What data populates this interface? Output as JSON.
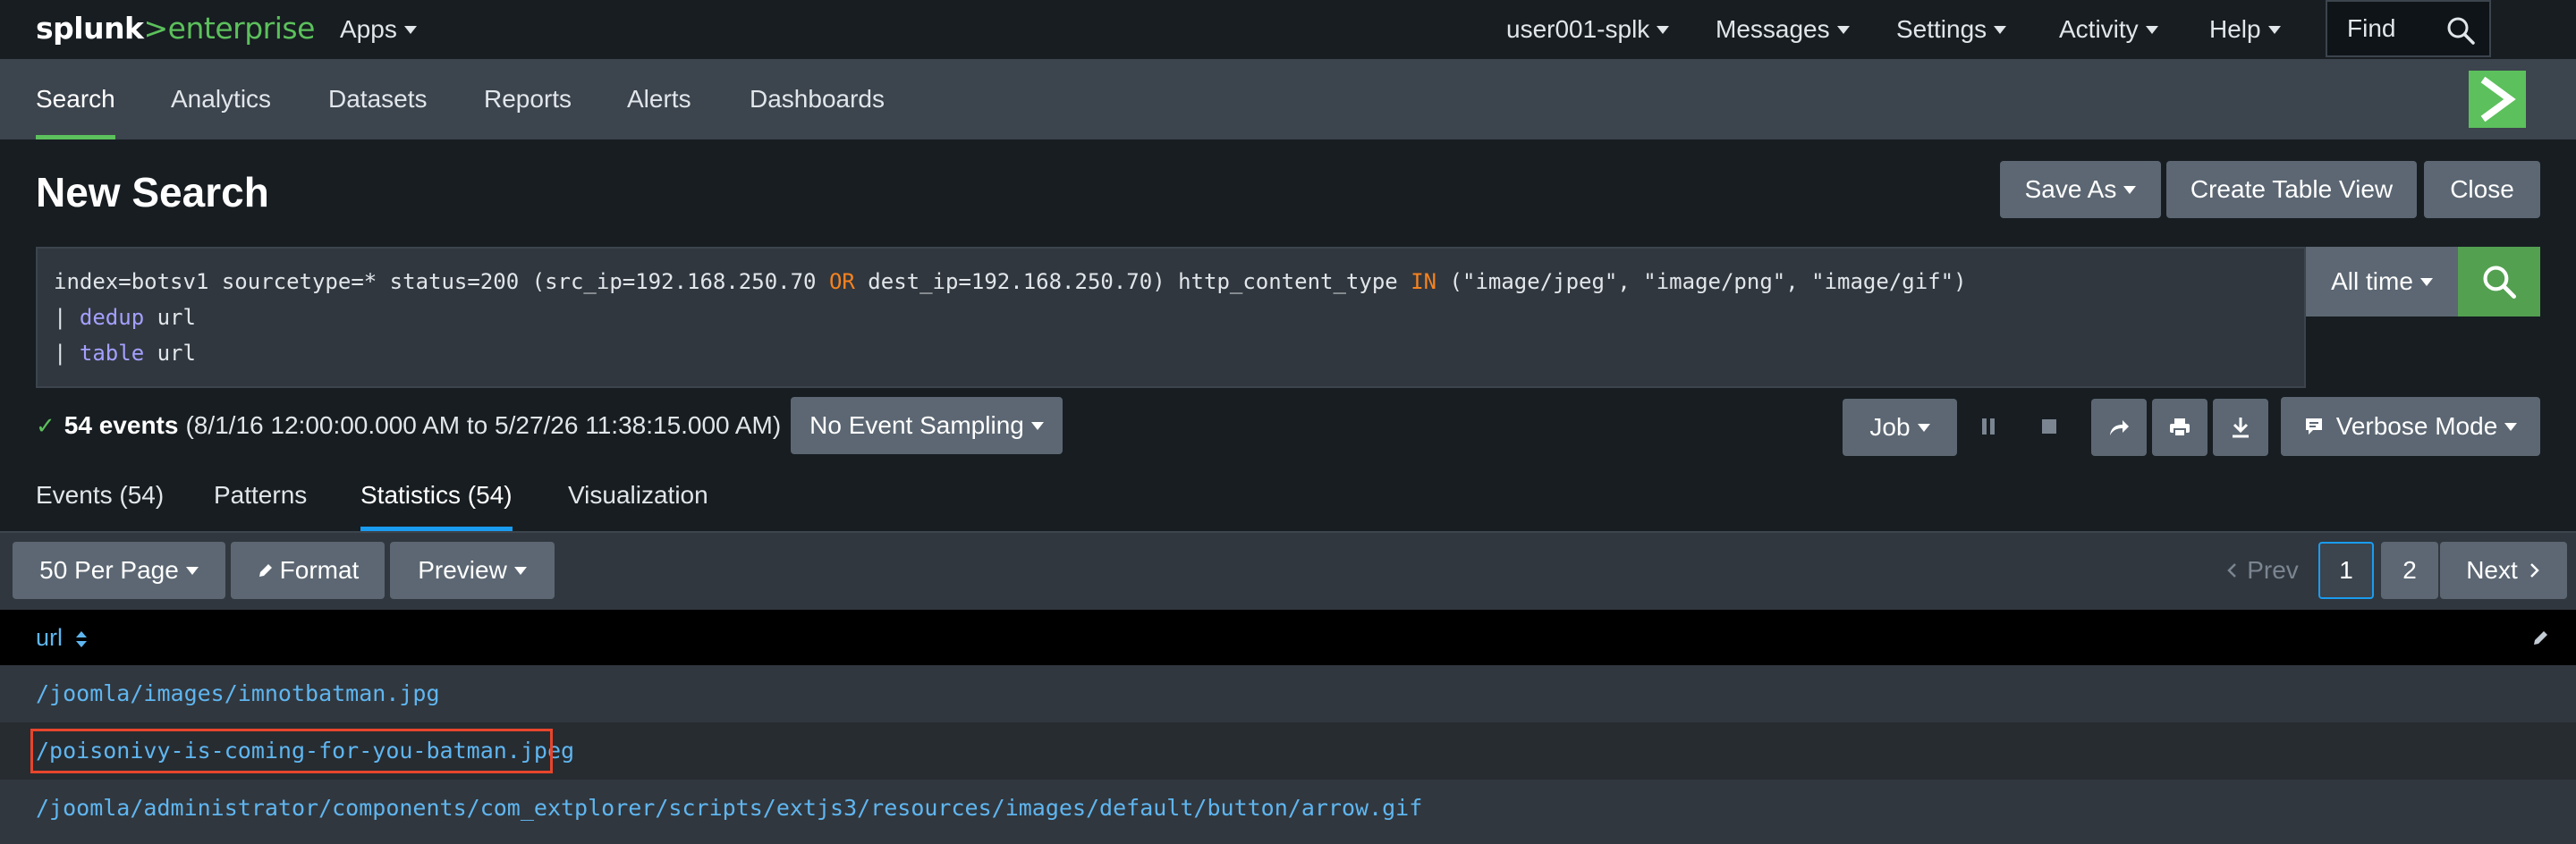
{
  "brand": {
    "part1": "splunk",
    "part2": ">enterprise"
  },
  "topmenu": {
    "apps": "Apps",
    "user": "user001-splk",
    "messages": "Messages",
    "settings": "Settings",
    "activity": "Activity",
    "help": "Help",
    "find_placeholder": "Find"
  },
  "nav": {
    "items": [
      "Search",
      "Analytics",
      "Datasets",
      "Reports",
      "Alerts",
      "Dashboards"
    ],
    "active": "Search"
  },
  "page": {
    "title": "New Search",
    "save_as": "Save As",
    "create_table_view": "Create Table View",
    "close": "Close"
  },
  "search": {
    "line1_a": "index=botsv1 sourcetype=* status=200 (src_ip=192.168.250.70 ",
    "line1_or": "OR",
    "line1_b": " dest_ip=192.168.250.70) http_content_type ",
    "line1_in": "IN",
    "line1_c": " (\"image/jpeg\", \"image/png\", \"image/gif\")",
    "line2_pipe": "| ",
    "line2_cmd": "dedup",
    "line2_arg": " url",
    "line3_pipe": "| ",
    "line3_cmd": "table",
    "line3_arg": " url",
    "time_range": "All time"
  },
  "status": {
    "check": "✓",
    "events": "54 events",
    "range": "(8/1/16 12:00:00.000 AM to 5/27/26 11:38:15.000 AM)",
    "sampling": "No Event Sampling",
    "job": "Job",
    "mode": "Verbose Mode"
  },
  "tabs": [
    "Events (54)",
    "Patterns",
    "Statistics (54)",
    "Visualization"
  ],
  "toolbar": {
    "per_page": "50 Per Page",
    "format": "Format",
    "preview": "Preview",
    "prev": "Prev",
    "page1": "1",
    "page2": "2",
    "next": "Next"
  },
  "table": {
    "column": "url",
    "rows": [
      "/joomla/images/imnotbatman.jpg",
      "/poisonivy-is-coming-for-you-batman.jpeg",
      "/joomla/administrator/components/com_extplorer/scripts/extjs3/resources/images/default/button/arrow.gif"
    ]
  },
  "colors": {
    "accent_green": "#5cc05c",
    "link_blue": "#5fb6f0",
    "highlight_red": "#e8452c",
    "tab_blue": "#1a9cf0"
  }
}
